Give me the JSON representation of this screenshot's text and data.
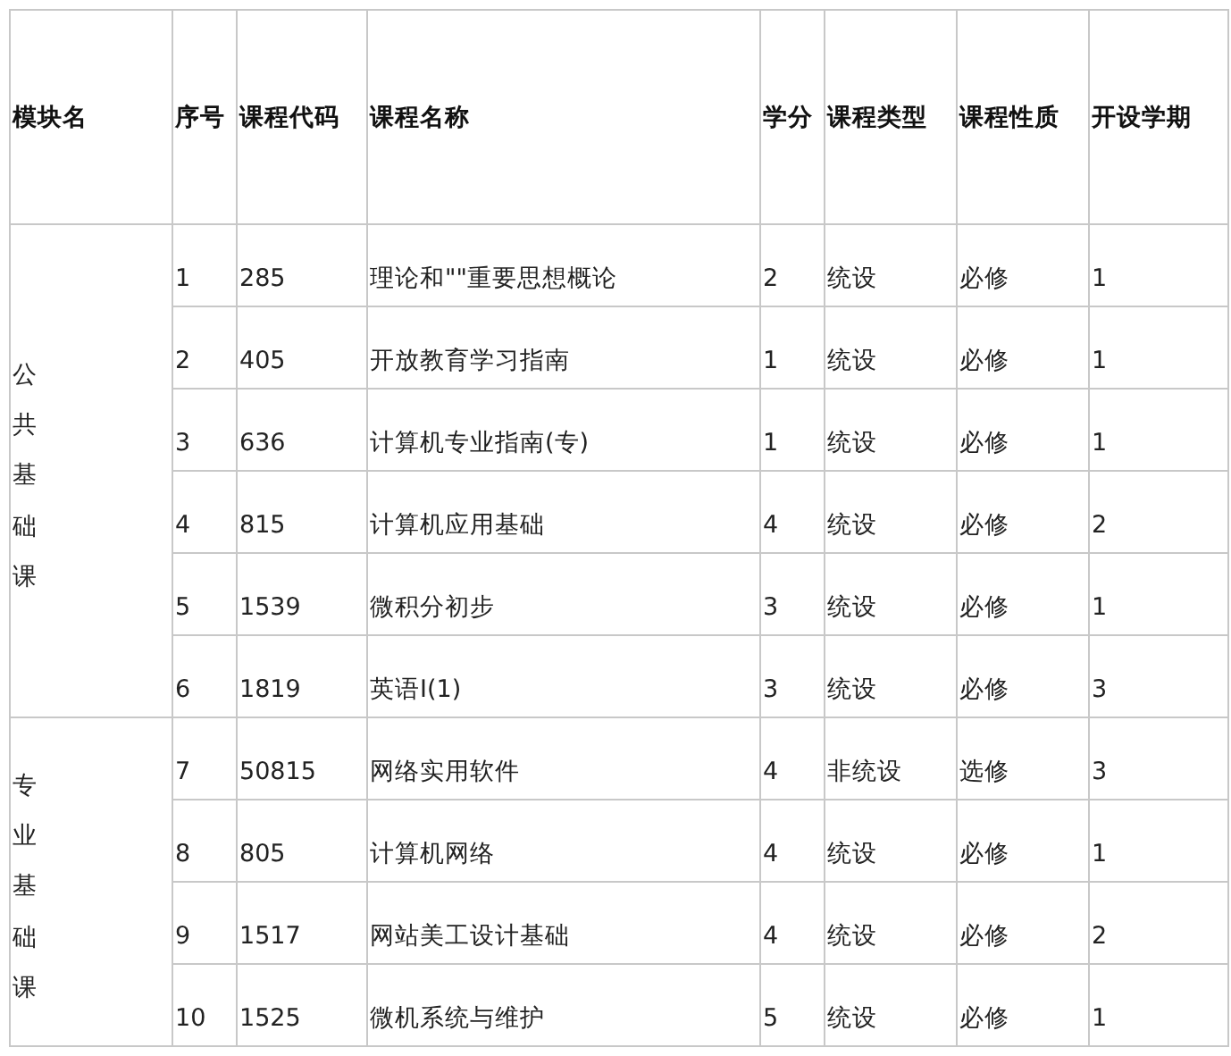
{
  "table": {
    "columns": [
      "模块名",
      "序号",
      "课程代码",
      "课程名称",
      "学分",
      "课程类型",
      "课程性质",
      "开设学期"
    ],
    "groups": [
      {
        "name": "公共基础课",
        "rows": [
          [
            "1",
            "285",
            "理论和\"\"重要思想概论",
            "2",
            "统设",
            "必修",
            "1"
          ],
          [
            "2",
            "405",
            "开放教育学习指南",
            "1",
            "统设",
            "必修",
            "1"
          ],
          [
            "3",
            "636",
            "计算机专业指南(专)",
            "1",
            "统设",
            "必修",
            "1"
          ],
          [
            "4",
            "815",
            "计算机应用基础",
            "4",
            "统设",
            "必修",
            "2"
          ],
          [
            "5",
            "1539",
            "微积分初步",
            "3",
            "统设",
            "必修",
            "1"
          ],
          [
            "6",
            "1819",
            "英语Ⅰ(1)",
            "3",
            "统设",
            "必修",
            "3"
          ]
        ]
      },
      {
        "name": "专业基础课",
        "rows": [
          [
            "7",
            "50815",
            "网络实用软件",
            "4",
            "非统设",
            "选修",
            "3"
          ],
          [
            "8",
            "805",
            "计算机网络",
            "4",
            "统设",
            "必修",
            "1"
          ],
          [
            "9",
            "1517",
            "网站美工设计基础",
            "4",
            "统设",
            "必修",
            "2"
          ],
          [
            "10",
            "1525",
            "微机系统与维护",
            "5",
            "统设",
            "必修",
            "1"
          ]
        ]
      }
    ]
  }
}
